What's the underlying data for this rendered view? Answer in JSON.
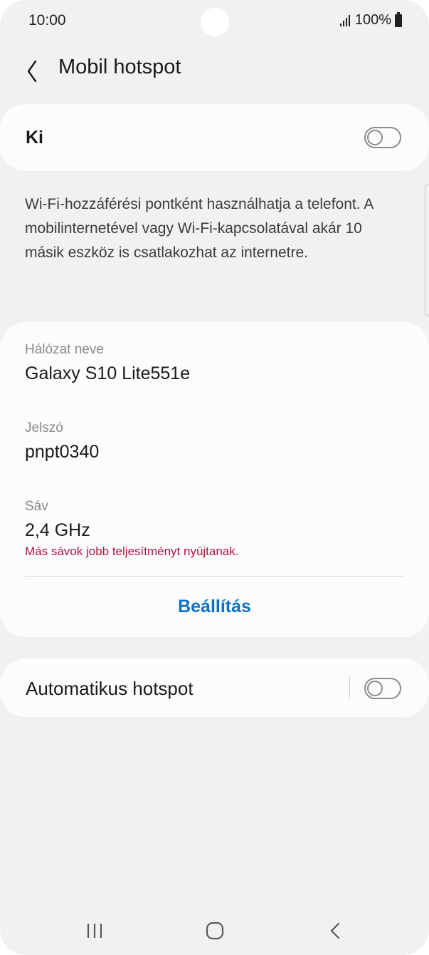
{
  "status_bar": {
    "time": "10:00",
    "battery": "100%"
  },
  "header": {
    "title": "Mobil hotspot",
    "back_icon": "chevron-left-icon"
  },
  "main_toggle": {
    "label": "Ki",
    "state": "off"
  },
  "description": "Wi-Fi-hozzáférési pontként használhatja a telefont. A mobilinternetével vagy Wi-Fi-kapcsolatával akár 10 másik eszköz is csatlakozhat az internetre.",
  "details": {
    "network_name_label": "Hálózat neve",
    "network_name_value": "Galaxy S10 Lite551e",
    "password_label": "Jelszó",
    "password_value": "pnpt0340",
    "band_label": "Sáv",
    "band_value": "2,4 GHz",
    "band_warning": "Más sávok jobb teljesítményt nyújtanak.",
    "settings_button": "Beállítás"
  },
  "auto_hotspot": {
    "label": "Automatikus hotspot",
    "state": "off"
  },
  "nav_bar": {
    "recents_icon": "recents-icon",
    "home_icon": "home-icon",
    "back_icon": "back-icon"
  },
  "colors": {
    "background": "#f1f1f1",
    "card": "#fcfcfc",
    "accent": "#0a72c8",
    "warning": "#b3123b"
  }
}
